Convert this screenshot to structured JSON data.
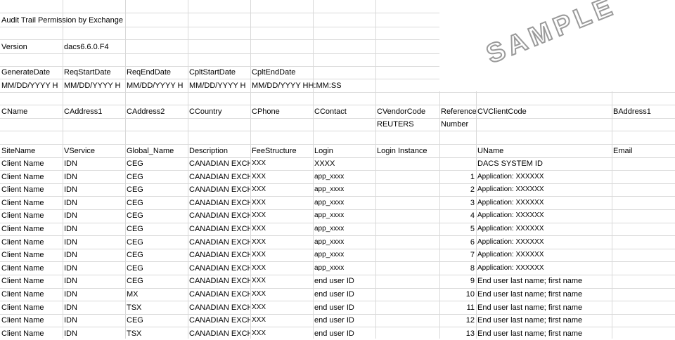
{
  "watermark": "SAMPLE",
  "title": "Audit Trail Permission by Exchange",
  "version": {
    "label": "Version",
    "value": "dacs6.6.0.F4"
  },
  "dates": {
    "headers": [
      "GenerateDate",
      "ReqStartDate",
      "ReqEndDate",
      "CpltStartDate",
      "CpltEndDate"
    ],
    "formats": [
      "MM/DD/YYYY H",
      "MM/DD/YYYY H",
      "MM/DD/YYYY H",
      "MM/DD/YYYY H",
      "MM/DD/YYYY HH:MM:SS"
    ]
  },
  "client": {
    "headers": [
      "CName",
      "CAddress1",
      "CAddress2",
      "CCountry",
      "CPhone",
      "CContact",
      "CVendorCode",
      "Reference",
      "CVClientCode",
      "BAddress1"
    ],
    "sub": {
      "vendor": "REUTERS",
      "reference": "Number"
    }
  },
  "table": {
    "headers": [
      "SiteName",
      "VService",
      "Global_Name",
      "Description",
      "FeeStructure",
      "Login",
      "Login Instance",
      "",
      "UName",
      "Email"
    ],
    "rows": [
      [
        "Client Name",
        "IDN",
        "CEG",
        "CANADIAN EXCH",
        "XXX",
        "XXXX",
        "",
        "",
        "DACS SYSTEM ID",
        ""
      ],
      [
        "Client Name",
        "IDN",
        "CEG",
        "CANADIAN EXCH",
        "XXX",
        "app_xxxx",
        "",
        "1",
        "Application: XXXXXX",
        ""
      ],
      [
        "Client Name",
        "IDN",
        "CEG",
        "CANADIAN EXCH",
        "XXX",
        "app_xxxx",
        "",
        "2",
        "Application: XXXXXX",
        ""
      ],
      [
        "Client Name",
        "IDN",
        "CEG",
        "CANADIAN EXCH",
        "XXX",
        "app_xxxx",
        "",
        "3",
        "Application: XXXXXX",
        ""
      ],
      [
        "Client Name",
        "IDN",
        "CEG",
        "CANADIAN EXCH",
        "XXX",
        "app_xxxx",
        "",
        "4",
        "Application: XXXXXX",
        ""
      ],
      [
        "Client Name",
        "IDN",
        "CEG",
        "CANADIAN EXCH",
        "XXX",
        "app_xxxx",
        "",
        "5",
        "Application: XXXXXX",
        ""
      ],
      [
        "Client Name",
        "IDN",
        "CEG",
        "CANADIAN EXCH",
        "XXX",
        "app_xxxx",
        "",
        "6",
        "Application: XXXXXX",
        ""
      ],
      [
        "Client Name",
        "IDN",
        "CEG",
        "CANADIAN EXCH",
        "XXX",
        "app_xxxx",
        "",
        "7",
        "Application: XXXXXX",
        ""
      ],
      [
        "Client Name",
        "IDN",
        "CEG",
        "CANADIAN EXCH",
        "XXX",
        "app_xxxx",
        "",
        "8",
        "Application: XXXXXX",
        ""
      ],
      [
        "Client Name",
        "IDN",
        "CEG",
        "CANADIAN EXCH",
        "XXX",
        "end user ID",
        "",
        "9",
        "End user last name; first name",
        ""
      ],
      [
        "Client Name",
        "IDN",
        "MX",
        "CANADIAN EXCH",
        "XXX",
        "end user ID",
        "",
        "10",
        "End user last name; first name",
        ""
      ],
      [
        "Client Name",
        "IDN",
        "TSX",
        "CANADIAN EXCH",
        "XXX",
        "end user ID",
        "",
        "11",
        "End user last name; first name",
        ""
      ],
      [
        "Client Name",
        "IDN",
        "CEG",
        "CANADIAN EXCH",
        "XXX",
        "end user ID",
        "",
        "12",
        "End user last name; first name",
        ""
      ],
      [
        "Client Name",
        "IDN",
        "TSX",
        "CANADIAN EXCH",
        "XXX",
        "end user ID",
        "",
        "13",
        "End user last name; first name",
        ""
      ]
    ]
  }
}
